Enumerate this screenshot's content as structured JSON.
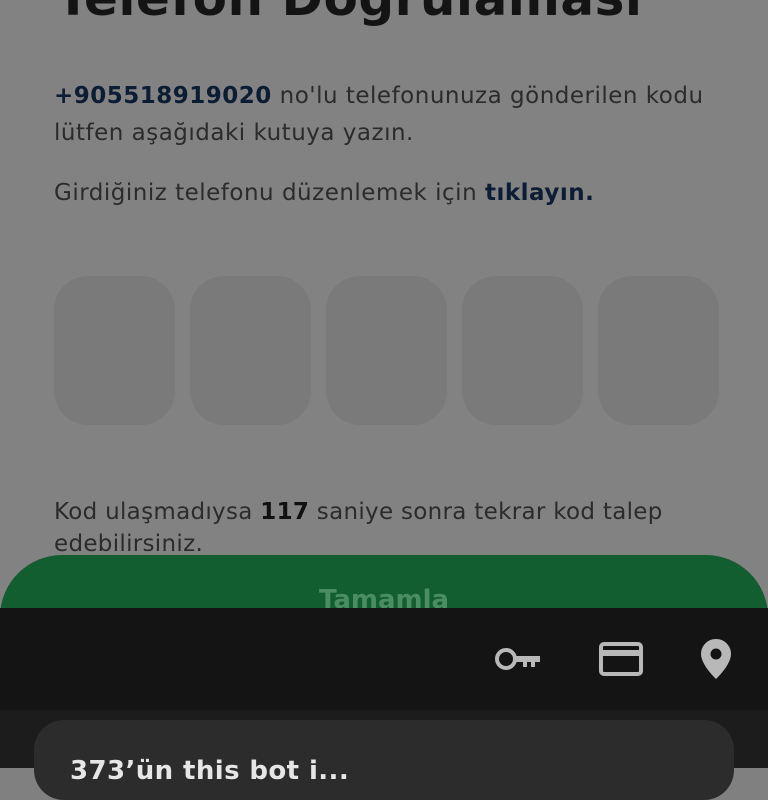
{
  "page": {
    "title": "Telefon Doğrulaması",
    "phone_number": "+905518919020",
    "message_rest": " no'lu telefonunuza gönderilen kodu lütfen aşağıdaki kutuya yazın.",
    "edit_prefix": "Girdiğiniz telefonu düzenlemek için ",
    "edit_link": "tıklayın.",
    "code_boxes": [
      "",
      "",
      "",
      "",
      ""
    ],
    "countdown_prefix": "Kod ulaşmadıysa ",
    "countdown_seconds": "117",
    "countdown_suffix": " saniye sonra tekrar kod talep edebilirsiniz.",
    "complete_button": "Tamamla"
  },
  "autofill": {
    "icons": [
      "key-icon",
      "credit-card-icon",
      "location-pin-icon"
    ],
    "icon_color": "#b8b8b8"
  },
  "bottom_sheet": {
    "text": "373’ün this bot i..."
  },
  "colors": {
    "accent_green": "#135e30",
    "link_navy": "#0c1c33"
  }
}
